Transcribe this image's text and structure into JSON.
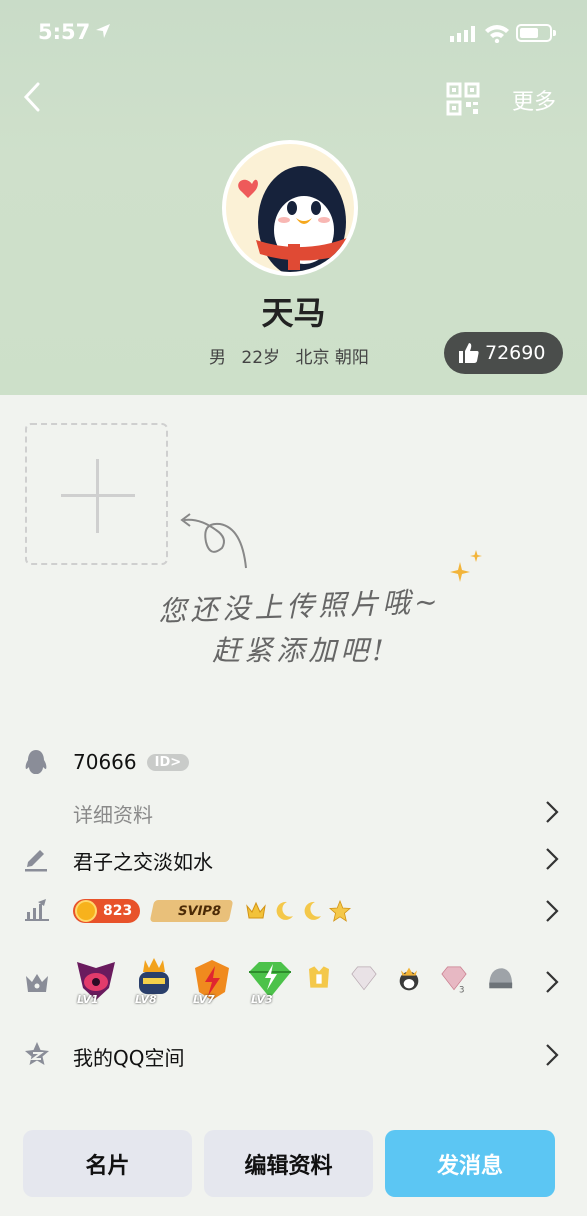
{
  "status_bar": {
    "time": "5:57"
  },
  "nav": {
    "more_label": "更多"
  },
  "profile": {
    "name": "天马",
    "gender": "男",
    "age": "22岁",
    "location": "北京 朝阳",
    "likes": "72690"
  },
  "photos": {
    "hint_line1": "您还没上传照片哦~",
    "hint_line2": "赶紧添加吧!"
  },
  "info": {
    "qq_number": "70666",
    "id_badge": "ID>",
    "detail_label": "详细资料",
    "signature": "君子之交淡如水",
    "level_coin": "823",
    "svip_label": "SVIP8",
    "medal_levels": [
      "LV1",
      "LV8",
      "LV7",
      "LV3"
    ],
    "qzone_label": "我的QQ空间"
  },
  "actions": {
    "card_label": "名片",
    "edit_label": "编辑资料",
    "message_label": "发消息"
  },
  "colors": {
    "header_bg": "#cde0c9",
    "message_button": "#5cc6f3",
    "like_badge": "#4a4d4b"
  }
}
